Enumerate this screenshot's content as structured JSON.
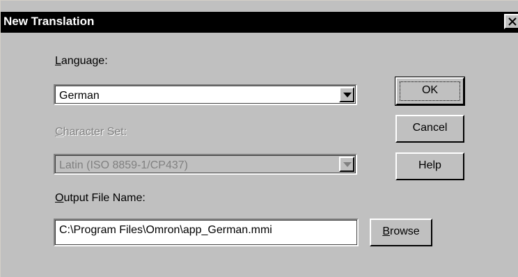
{
  "dialog": {
    "title": "New Translation",
    "close_icon": "close-icon"
  },
  "language": {
    "label_underlined": "L",
    "label_rest": "anguage:",
    "selected": "German"
  },
  "character_set": {
    "label_underlined": "C",
    "label_rest": "haracter Set:",
    "selected": "Latin (ISO 8859-1/CP437)",
    "disabled": true
  },
  "output_file": {
    "label_underlined": "O",
    "label_rest": "utput File Name:",
    "value": "C:\\Program Files\\Omron\\app_German.mmi"
  },
  "buttons": {
    "ok": "OK",
    "cancel": "Cancel",
    "help": "Help",
    "browse_underlined": "B",
    "browse_rest": "rowse"
  },
  "colors": {
    "face": "#c0c0c0",
    "titlebar": "#000000",
    "disabled_text": "#808080"
  }
}
